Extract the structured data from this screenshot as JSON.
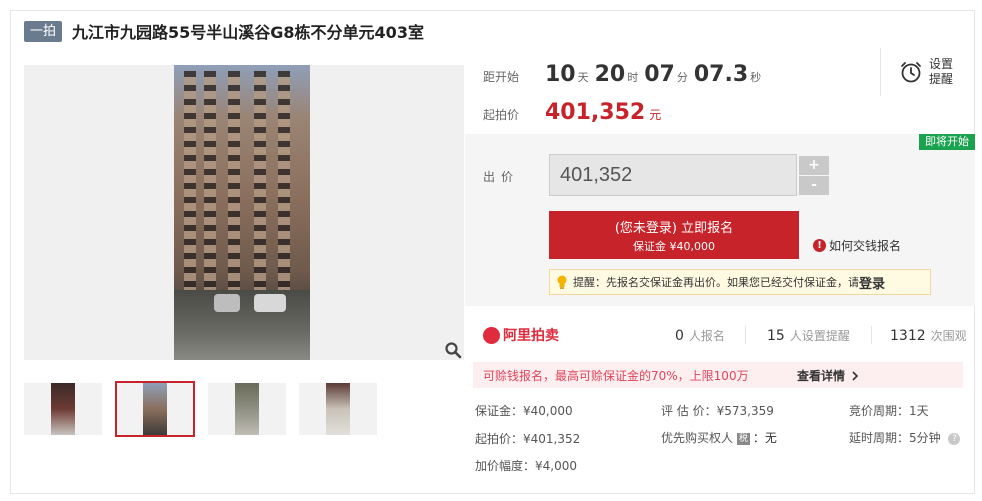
{
  "header": {
    "badge": "一拍",
    "title": "九江市九园路55号半山溪谷G8栋不分单元403室"
  },
  "gallery": {
    "thumbnail_count": 4,
    "active_thumbnail": 2
  },
  "countdown": {
    "label": "距开始",
    "days": "10",
    "days_unit": "天",
    "hours": "20",
    "hours_unit": "时",
    "minutes": "07",
    "minutes_unit": "分",
    "seconds": "07.3",
    "seconds_unit": "秒"
  },
  "reminder": {
    "label": "设置提醒"
  },
  "start_price": {
    "label": "起拍价",
    "value": "401,352",
    "unit": "元"
  },
  "bid": {
    "status_tag": "即将开始",
    "label": "出价",
    "input_value": "401,352",
    "plus": "+",
    "minus": "-",
    "signup_main": "(您未登录) 立即报名",
    "signup_sub": "保证金 ¥40,000",
    "how_to_pay": "如何交钱报名",
    "tip_text": "提醒：先报名交保证金再出价。如果您已经交付保证金，请",
    "tip_link": "登录"
  },
  "platform": {
    "logo_text": "阿里拍卖",
    "signups_num": "0",
    "signups_label": "人报名",
    "reminders_num": "15",
    "reminders_label": "人设置提醒",
    "views_num": "1312",
    "views_label": "次围观"
  },
  "banner": {
    "text": "可赊钱报名，最高可赊保证金的70%，上限100万",
    "link": "查看详情"
  },
  "details": {
    "deposit": "保证金：¥40,000",
    "appraisal": "评 估 价：¥573,359",
    "bid_cycle": "竞价周期：1天",
    "start_price": "起拍价：¥401,352",
    "priority_label": "优先购买权人",
    "priority_badge": "税",
    "priority_value": "：无",
    "delay_cycle": "延时周期：5分钟",
    "increment": "加价幅度：¥4,000"
  },
  "colors": {
    "accent": "#c7232a",
    "status_green": "#1aa24f",
    "badge_gray": "#6b7b8f",
    "ali_red": "#e02b3d"
  }
}
